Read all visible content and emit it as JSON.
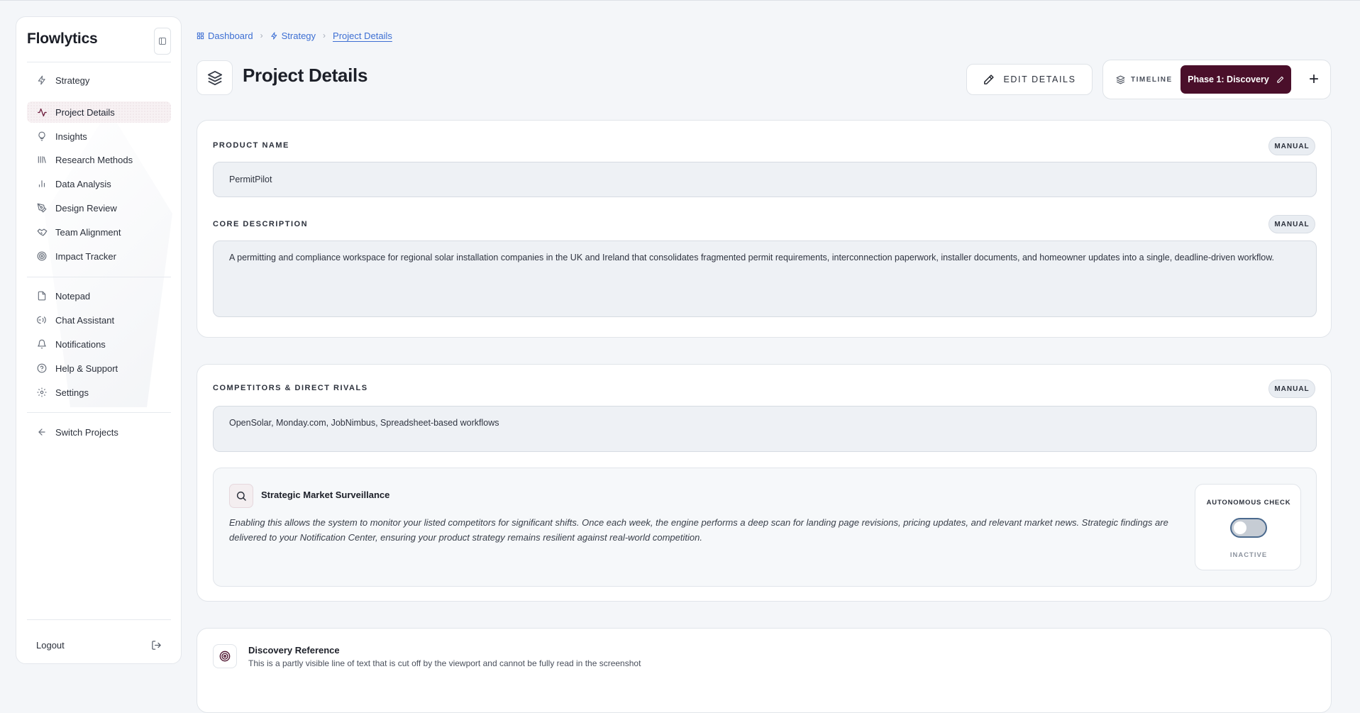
{
  "app": {
    "brand": "Flowlytics"
  },
  "sidebar": {
    "items": [
      {
        "label": "Strategy",
        "icon": "zap-icon"
      },
      {
        "label": "Project Details",
        "icon": "activity-icon",
        "active": true
      },
      {
        "label": "Insights",
        "icon": "lightbulb-icon"
      },
      {
        "label": "Research Methods",
        "icon": "library-icon"
      },
      {
        "label": "Data Analysis",
        "icon": "bar-chart-icon"
      },
      {
        "label": "Design Review",
        "icon": "pen-tool-icon"
      },
      {
        "label": "Team Alignment",
        "icon": "handshake-icon"
      },
      {
        "label": "Impact Tracker",
        "icon": "target-icon"
      },
      {
        "label": "Notepad",
        "icon": "file-icon"
      },
      {
        "label": "Chat Assistant",
        "icon": "chat-icon"
      },
      {
        "label": "Notifications",
        "icon": "bell-icon"
      },
      {
        "label": "Help & Support",
        "icon": "help-circle-icon"
      },
      {
        "label": "Settings",
        "icon": "gear-icon"
      },
      {
        "label": "Switch Projects",
        "icon": "arrow-left-icon"
      }
    ],
    "logout_label": "Logout"
  },
  "breadcrumb": {
    "items": [
      "Dashboard",
      "Strategy",
      "Project Details"
    ]
  },
  "header": {
    "title": "Project Details",
    "edit_label": "EDIT DETAILS",
    "timeline_label": "TIMELINE",
    "phase_label": "Phase 1: Discovery",
    "add_label": "+"
  },
  "product": {
    "name_label": "PRODUCT NAME",
    "name_badge": "MANUAL",
    "name_value": "PermitPilot",
    "desc_label": "CORE DESCRIPTION",
    "desc_badge": "MANUAL",
    "desc_value": "A permitting and compliance workspace for regional solar installation companies in the UK and Ireland that consolidates fragmented permit requirements, interconnection paperwork, installer documents, and homeowner updates into a single, deadline-driven workflow."
  },
  "competitors": {
    "label": "COMPETITORS & DIRECT RIVALS",
    "badge": "MANUAL",
    "value": "OpenSolar, Monday.com, JobNimbus, Spreadsheet-based workflows",
    "surveillance": {
      "title": "Strategic Market Surveillance",
      "description": "Enabling this allows the system to monitor your listed competitors for significant shifts. Once each week, the engine performs a deep scan for landing page revisions, pricing updates, and relevant market news. Strategic findings are delivered to your Notification Center, ensuring your product strategy remains resilient against real-world competition.",
      "auto_label": "AUTONOMOUS CHECK",
      "toggle_on": false,
      "status": "INACTIVE"
    }
  },
  "reference": {
    "title": "Discovery Reference",
    "text": "This is a partly visible line of text that is cut off by the viewport and cannot be fully read in the screenshot"
  },
  "colors": {
    "accent": "#4a0f2a",
    "link": "#3d6fd3",
    "background": "#f4f6f9"
  }
}
